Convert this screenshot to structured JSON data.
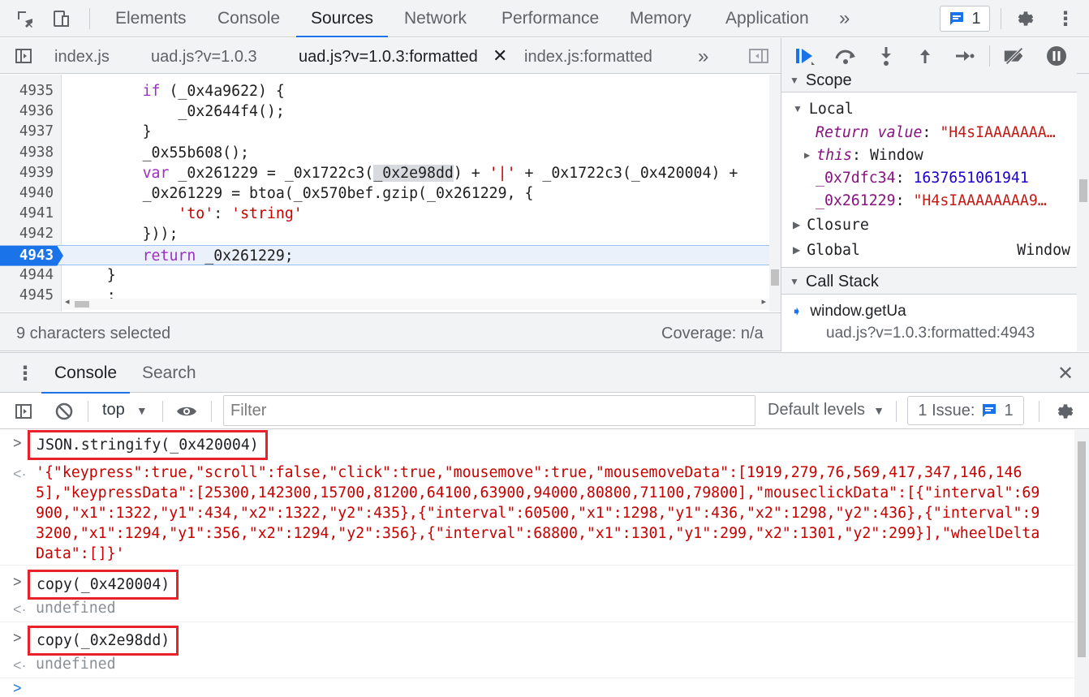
{
  "top_tabs": [
    "Elements",
    "Console",
    "Sources",
    "Network",
    "Performance",
    "Memory",
    "Application"
  ],
  "active_top_tab": "Sources",
  "issues_count": "1",
  "file_tabs": [
    "index.js",
    "uad.js?v=1.0.3",
    "uad.js?v=1.0.3:formatted",
    "index.js:formatted"
  ],
  "active_file_tab": "uad.js?v=1.0.3:formatted",
  "code_lines": [
    {
      "n": "4935",
      "html": "        <span class=\"kw\">if</span> (_0x4a9622) {"
    },
    {
      "n": "4936",
      "html": "            _0x2644f4();"
    },
    {
      "n": "4937",
      "html": "        }"
    },
    {
      "n": "4938",
      "html": "        _0x55b608();"
    },
    {
      "n": "4939",
      "html": "        <span class=\"kw\">var</span> _0x261229 = _0x1722c3(<span class=\"sel\">_0x2e98dd</span>) + <span class=\"str\">'|'</span> + _0x1722c3(_0x420004) +"
    },
    {
      "n": "4940",
      "html": "        _0x261229 = btoa(_0x570bef.gzip(_0x261229, {"
    },
    {
      "n": "4941",
      "html": "            <span class=\"str\">'to'</span>: <span class=\"str\">'string'</span>"
    },
    {
      "n": "4942",
      "html": "        }));"
    },
    {
      "n": "4943",
      "html": "        <span class=\"kw\">return</span> _0x261229;",
      "exec": true
    },
    {
      "n": "4944",
      "html": "    }"
    },
    {
      "n": "4945",
      "html": "    ;"
    }
  ],
  "status": {
    "selected": "9 characters selected",
    "coverage": "Coverage: n/a"
  },
  "scope": {
    "title": "Scope",
    "local_label": "Local",
    "return_value_name": "Return value",
    "return_value": "\"H4sIAAAAAAA…",
    "this_name": "this",
    "this_value": "Window",
    "var1_name": "_0x7dfc34",
    "var1_value": "1637651061941",
    "var2_name": "_0x261229",
    "var2_value": "\"H4sIAAAAAAAA9…",
    "closure_label": "Closure",
    "global_label": "Global",
    "global_value": "Window"
  },
  "call_stack": {
    "title": "Call Stack",
    "frame_name": "window.getUa",
    "frame_location": "uad.js?v=1.0.3:formatted:4943"
  },
  "drawer_tabs": [
    "Console",
    "Search"
  ],
  "console_toolbar": {
    "context": "top",
    "filter_placeholder": "Filter",
    "levels": "Default levels",
    "issues_label": "1 Issue:",
    "issues_count": "1"
  },
  "console_entries": [
    {
      "cmd": "JSON.stringify(_0x420004)",
      "result": "'{\"keypress\":true,\"scroll\":false,\"click\":true,\"mousemove\":true,\"mousemoveData\":[1919,279,76,569,417,347,146,1465],\"keypressData\":[25300,142300,15700,81200,64100,63900,94000,80800,71100,79800],\"mouseclickData\":[{\"interval\":69900,\"x1\":1322,\"y1\":434,\"x2\":1322,\"y2\":435},{\"interval\":60500,\"x1\":1298,\"y1\":436,\"x2\":1298,\"y2\":436},{\"interval\":93200,\"x1\":1294,\"y1\":356,\"x2\":1294,\"y2\":356},{\"interval\":68800,\"x1\":1301,\"y1\":299,\"x2\":1301,\"y2\":299}],\"wheelDeltaData\":[]}'"
    },
    {
      "cmd": "copy(_0x420004)",
      "result": "undefined"
    },
    {
      "cmd": "copy(_0x2e98dd)",
      "result": "undefined"
    }
  ],
  "colors": {
    "accent": "#1a73e8",
    "highlight_box": "#e8212b",
    "string": "#c80000",
    "keyword": "#9d2ec5"
  }
}
